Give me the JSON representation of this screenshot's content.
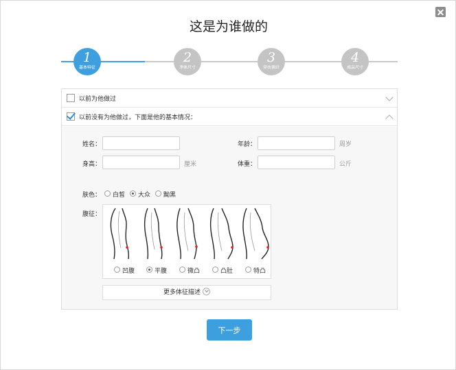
{
  "dialog": {
    "title": "这是为谁做的",
    "close_icon": "close-icon"
  },
  "steps": [
    {
      "number": "1",
      "label": "基本特征",
      "active": true
    },
    {
      "number": "2",
      "label": "净体尺寸",
      "active": false
    },
    {
      "number": "3",
      "label": "穿衣偏好",
      "active": false
    },
    {
      "number": "4",
      "label": "成品尺寸",
      "active": false
    }
  ],
  "options": {
    "made_before": {
      "label": "以前为他做过",
      "checked": false
    },
    "not_made_before": {
      "label": "以前没有为他做过，下面是他的基本情况：",
      "checked": true
    }
  },
  "form": {
    "name": {
      "label": "姓名：",
      "value": ""
    },
    "age": {
      "label": "年龄：",
      "value": "",
      "unit": "周岁"
    },
    "height": {
      "label": "身高：",
      "value": "",
      "unit": "厘米"
    },
    "weight": {
      "label": "体重：",
      "value": "",
      "unit": "公斤"
    },
    "skin": {
      "label": "肤色：",
      "options": [
        "白皙",
        "大众",
        "黝黑"
      ],
      "selected": "大众"
    },
    "belly": {
      "label": "腹征：",
      "options": [
        "凹腹",
        "平腹",
        "微凸",
        "凸肚",
        "特凸"
      ],
      "selected": "平腹"
    },
    "more_label": "更多体征描述"
  },
  "next_button": "下一步",
  "colors": {
    "accent": "#3d9fdd",
    "inactive_step": "#c4c4c4",
    "belly_marker": "#e02020"
  }
}
